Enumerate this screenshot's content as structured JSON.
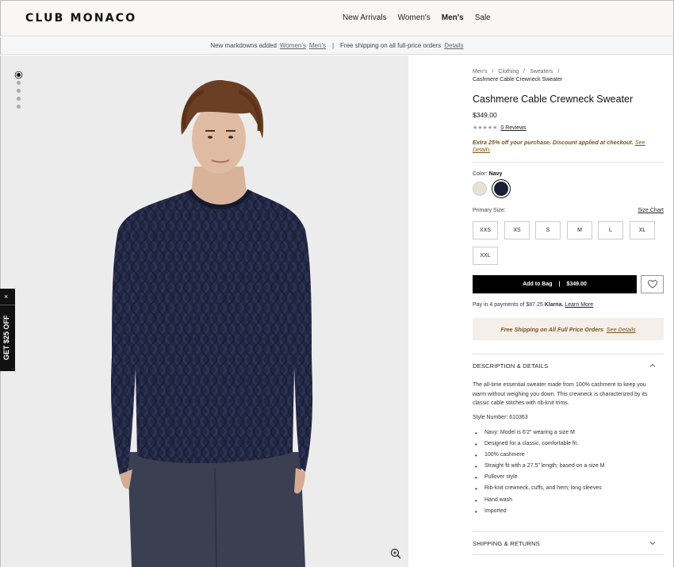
{
  "header": {
    "logo": "CLUB MONACO",
    "nav": [
      "New Arrivals",
      "Women's",
      "Men's",
      "Sale"
    ],
    "active_nav": "Men's"
  },
  "promo_bar": {
    "text": "New markdowns added",
    "link_women": "Women's",
    "link_men": "Men's",
    "separator": "|",
    "shipping_text": "Free shipping on all full-price orders",
    "details_link": "Details"
  },
  "gallery": {
    "dot_count": 5,
    "active_dot": 0
  },
  "side_promo": {
    "close": "×",
    "label": "GET $25 OFF"
  },
  "breadcrumb": {
    "items": [
      "Men's",
      "Clothing",
      "Sweaters"
    ],
    "current": "Cashmere Cable Crewneck Sweater"
  },
  "product": {
    "title": "Cashmere Cable Crewneck Sweater",
    "price": "$349.00",
    "stars": "★★★★★",
    "reviews": "0 Reviews",
    "extra_offer": "Extra 25% off your purchase. Discount applied at checkout.",
    "see_details": "See Details",
    "color_label": "Color:",
    "color_value": "Navy",
    "swatches": [
      {
        "name": "Cream",
        "hex": "#e7e2d3"
      },
      {
        "name": "Navy",
        "hex": "#1b1f33"
      }
    ],
    "size_label": "Primary Size:",
    "size_chart": "Size Chart",
    "sizes": [
      "XXS",
      "XS",
      "S",
      "M",
      "L",
      "XL",
      "XXL"
    ],
    "add_to_bag": "Add to Bag",
    "bag_sep": "|",
    "bag_price": "$349.00",
    "klarna_text": "Pay in 4 payments of $87.25",
    "klarna_brand": "Klarna.",
    "learn_more": "Learn More",
    "ship_banner": "Free Shipping on All Full Price Orders",
    "ship_link": "See Details"
  },
  "description": {
    "heading": "DESCRIPTION & DETAILS",
    "body": "The all-time essential sweater made from 100% cashmere to keep you warm without weighing you down. This crewneck is characterized by its classic cable stitches with rib-knit trims.",
    "style_number": "Style Number: 610363",
    "bullets": [
      "Navy: Model is 6'2\" wearing a size M",
      "Designed for a classic, comfortable fit.",
      "100% cashmere",
      "Straight fit with a 27.5\" length; based on a size M",
      "Pullover style",
      "Rib-knit crewneck, cuffs, and hem; long sleeves",
      "Hand wash",
      "Imported"
    ]
  },
  "shipping_returns": {
    "heading": "SHIPPING & RETURNS"
  }
}
